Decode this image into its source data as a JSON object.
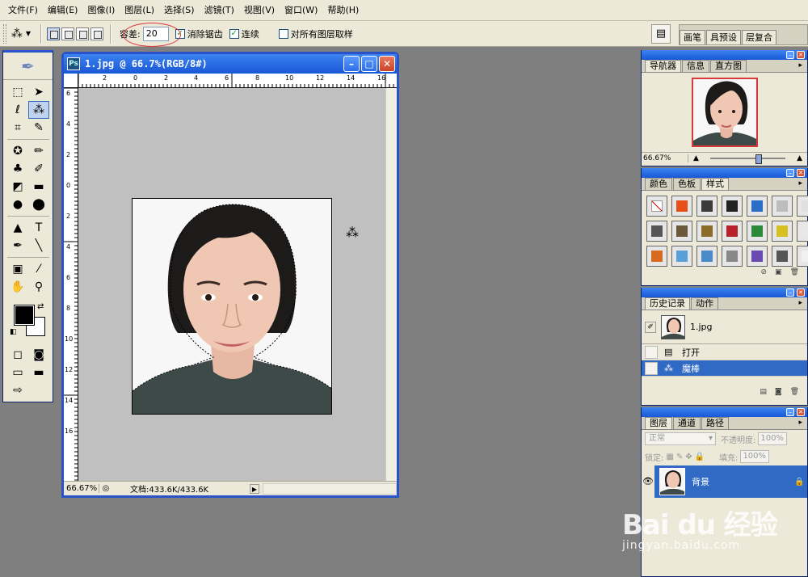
{
  "menu": [
    "文件(F)",
    "编辑(E)",
    "图像(I)",
    "图层(L)",
    "选择(S)",
    "滤镜(T)",
    "视图(V)",
    "窗口(W)",
    "帮助(H)"
  ],
  "options": {
    "tolerance_label": "容差:",
    "tolerance_value": "20",
    "anti_alias_label": "消除锯齿",
    "contiguous_label": "连续",
    "sample_all_label": "对所有图层取样",
    "well_tabs": [
      "画笔",
      "具预设",
      "层复合"
    ]
  },
  "document": {
    "title": "1.jpg @ 66.7%(RGB/8#)",
    "zoom": "66.67%",
    "doc_size": "文档:433.6K/433.6K",
    "ruler_top": [
      "2",
      "0",
      "2",
      "4",
      "6",
      "8",
      "10",
      "12",
      "14",
      "16"
    ],
    "ruler_left": [
      "6",
      "4",
      "2",
      "0",
      "2",
      "4",
      "6",
      "8",
      "10",
      "12",
      "14",
      "16"
    ]
  },
  "navigator": {
    "tabs": [
      "导航器",
      "信息",
      "直方图"
    ],
    "zoom": "66.67%"
  },
  "styles": {
    "tabs": [
      "颜色",
      "色板",
      "样式"
    ],
    "swatches": [
      "#ffffff",
      "#e8501a",
      "#3a3a3a",
      "#222222",
      "#2b6cc4",
      "#bdbdbd",
      "#e0e0e0",
      "#555555",
      "#6b5a3a",
      "#8a6b2a",
      "#b8202a",
      "#2a8a3a",
      "#d8c020",
      "#e8e8e8",
      "#d86a20",
      "#5aa0d8",
      "#4a8ac8",
      "#888888",
      "#6a4ab0",
      "#555555",
      "#f0f0f0"
    ]
  },
  "history": {
    "tabs": [
      "历史记录",
      "动作"
    ],
    "snapshot": "1.jpg",
    "items": [
      "打开",
      "魔棒"
    ]
  },
  "layers": {
    "tabs": [
      "图层",
      "通道",
      "路径"
    ],
    "blend_mode": "正常",
    "opacity_label": "不透明度:",
    "opacity_value": "100%",
    "lock_label": "锁定:",
    "fill_label": "填充:",
    "fill_value": "100%",
    "layer_name": "背景"
  },
  "watermark": {
    "logo": "Bai du 经验",
    "url": "jingyan.baidu.com"
  }
}
